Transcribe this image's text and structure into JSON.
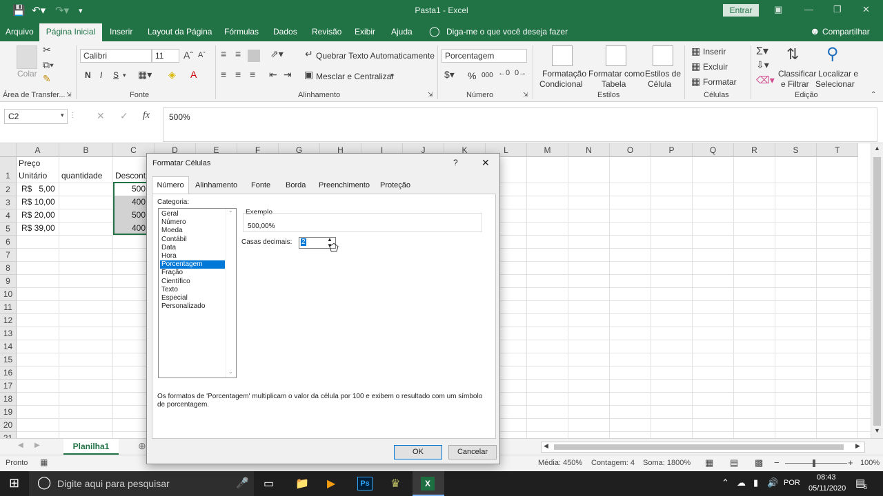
{
  "title_bar": {
    "title": "Pasta1 - Excel",
    "signin_label": "Entrar"
  },
  "menu": {
    "tabs": [
      "Arquivo",
      "Página Inicial",
      "Inserir",
      "Layout da Página",
      "Fórmulas",
      "Dados",
      "Revisão",
      "Exibir",
      "Ajuda"
    ],
    "tell_me": "Diga-me o que você deseja fazer",
    "share": "Compartilhar"
  },
  "ribbon": {
    "clipboard": {
      "paste": "Colar",
      "label": "Área de Transfer..."
    },
    "font": {
      "name": "Calibri",
      "size": "11",
      "bold": "N",
      "italic": "I",
      "underline": "S",
      "label": "Fonte"
    },
    "alignment": {
      "wrap": "Quebrar Texto Automaticamente",
      "merge": "Mesclar e Centralizar",
      "label": "Alinhamento"
    },
    "number": {
      "format": "Porcentagem",
      "percent": "%",
      "thousands": "000",
      "label": "Número"
    },
    "styles": {
      "cond_format_1": "Formatação",
      "cond_format_2": "Condicional",
      "table_1": "Formatar como",
      "table_2": "Tabela",
      "cell_styles_1": "Estilos de",
      "cell_styles_2": "Célula",
      "label": "Estilos"
    },
    "cells": {
      "insert": "Inserir",
      "delete": "Excluir",
      "format": "Formatar",
      "label": "Células"
    },
    "editing": {
      "sort_1": "Classificar",
      "sort_2": "e Filtrar",
      "find_1": "Localizar e",
      "find_2": "Selecionar",
      "label": "Edição"
    }
  },
  "formula_bar": {
    "name_box": "C2",
    "fx": "fx",
    "formula": "500%"
  },
  "sheet": {
    "columns": [
      "A",
      "B",
      "C",
      "D",
      "E",
      "F",
      "G",
      "H",
      "I",
      "J",
      "K",
      "L",
      "M",
      "N",
      "O",
      "P",
      "Q",
      "R",
      "S",
      "T"
    ],
    "rows": [
      "1",
      "2",
      "3",
      "4",
      "5",
      "6",
      "7",
      "8",
      "9",
      "10",
      "11",
      "12",
      "13",
      "14",
      "15",
      "16",
      "17",
      "18",
      "19",
      "20",
      "21"
    ],
    "a1_line1": "Preço",
    "a1_line2": "Unitário",
    "b1": "quantidade",
    "c1": "Descont",
    "a_values": [
      "R$   5,00",
      "R$ 10,00",
      "R$ 20,00",
      "R$ 39,00"
    ],
    "c_values": [
      "500",
      "400",
      "500",
      "400"
    ],
    "tab": "Planilha1"
  },
  "status_bar": {
    "ready": "Pronto",
    "average": "Média: 450%",
    "count": "Contagem: 4",
    "sum": "Soma: 1800%",
    "zoom": "100%"
  },
  "taskbar": {
    "search_placeholder": "Digite aqui para pesquisar",
    "language": "POR",
    "time": "08:43",
    "date": "05/11/2020",
    "notifications": "5"
  },
  "dialog": {
    "title": "Formatar Células",
    "tabs": [
      "Número",
      "Alinhamento",
      "Fonte",
      "Borda",
      "Preenchimento",
      "Proteção"
    ],
    "category_label": "Categoria:",
    "categories": [
      "Geral",
      "Número",
      "Moeda",
      "Contábil",
      "Data",
      "Hora",
      "Porcentagem",
      "Fração",
      "Científico",
      "Texto",
      "Especial",
      "Personalizado"
    ],
    "selected_category": "Porcentagem",
    "sample_label": "Exemplo",
    "sample_value": "500,00%",
    "decimals_label": "Casas decimais:",
    "decimals_value": "2",
    "description": "Os formatos de 'Porcentagem' multiplicam o valor da célula por 100 e exibem o resultado com um símbolo de porcentagem.",
    "ok": "OK",
    "cancel": "Cancelar"
  },
  "colors": {
    "excel_green": "#217346",
    "selection_blue": "#0078d7"
  }
}
